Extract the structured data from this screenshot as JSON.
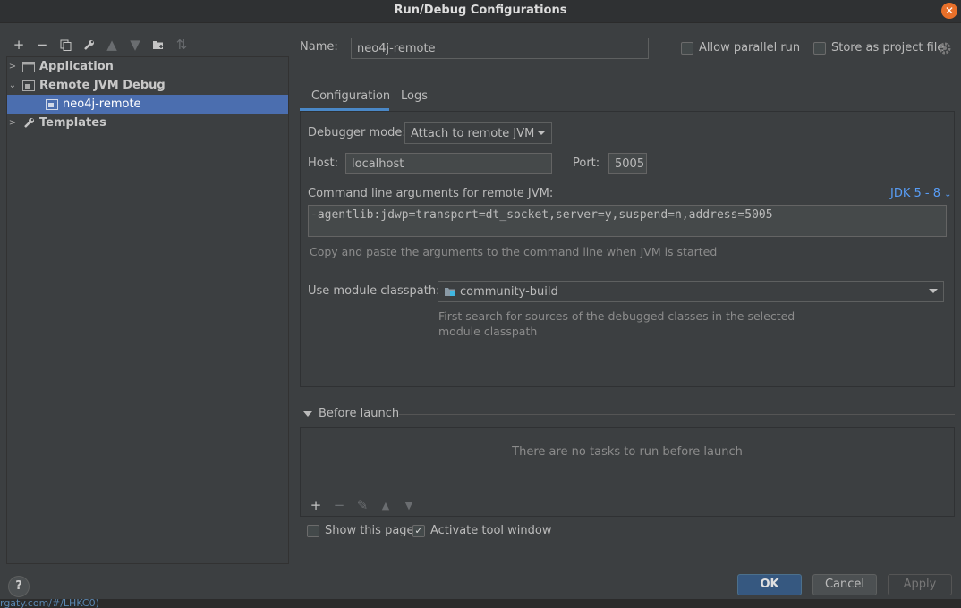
{
  "window": {
    "title": "Run/Debug Configurations"
  },
  "tree": {
    "items": [
      {
        "label": "Application",
        "expanded": false
      },
      {
        "label": "Remote JVM Debug",
        "expanded": true
      },
      {
        "label": "neo4j-remote",
        "selected": true
      },
      {
        "label": "Templates",
        "expanded": false
      }
    ]
  },
  "header": {
    "name_label": "Name:",
    "name_value": "neo4j-remote",
    "allow_parallel": "Allow parallel run",
    "store_project": "Store as project file"
  },
  "tabs": [
    {
      "label": "Configuration"
    },
    {
      "label": "Logs"
    }
  ],
  "config": {
    "debugger_mode_label": "Debugger mode:",
    "debugger_mode_value": "Attach to remote JVM",
    "host_label": "Host:",
    "host_value": "localhost",
    "port_label": "Port:",
    "port_value": "5005",
    "cmd_label": "Command line arguments for remote JVM:",
    "jdk_link": "JDK 5 - 8",
    "cmd_value": "-agentlib:jdwp=transport=dt_socket,server=y,suspend=n,address=5005",
    "cmd_hint": "Copy and paste the arguments to the command line when JVM is started",
    "module_label": "Use module classpath:",
    "module_value": "community-build",
    "module_hint_1": "First search for sources of the debugged classes in the selected",
    "module_hint_2": "module classpath"
  },
  "before_launch": {
    "title": "Before launch",
    "empty": "There are no tasks to run before launch"
  },
  "options": {
    "show_page": "Show this page",
    "activate_tool": "Activate tool window"
  },
  "buttons": {
    "ok": "OK",
    "cancel": "Cancel",
    "apply": "Apply",
    "help": "?"
  },
  "bottom_text": "rgaty.com/#/LHKC0)"
}
